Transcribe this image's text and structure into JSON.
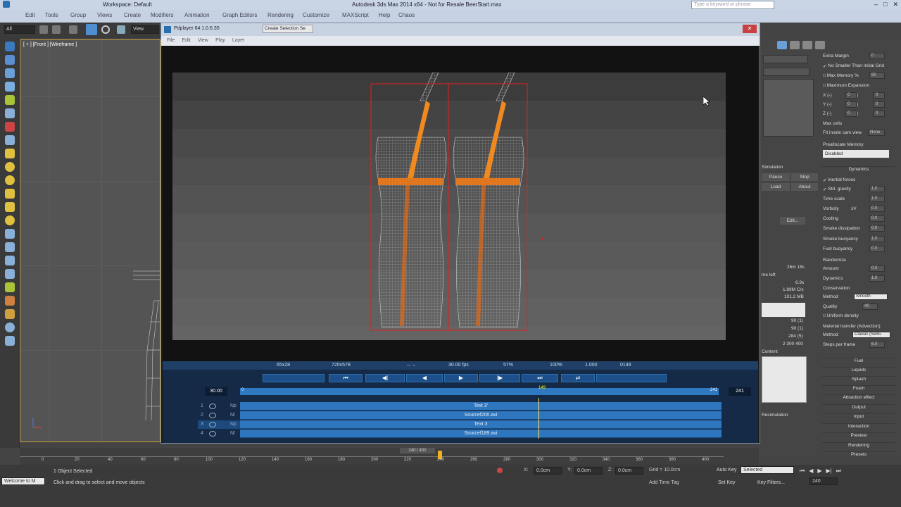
{
  "titlebar": {
    "workspace": "Workspace: Default",
    "title": "Autodesk 3ds Max 2014 x64  -  Not for Resale  BeerStart.max",
    "search_placeholder": "Type a keyword or phrase"
  },
  "menubar": {
    "items": [
      "Edit",
      "Tools",
      "Group",
      "Views",
      "Create",
      "Modifiers",
      "Animation",
      "Graph Editors",
      "Rendering",
      "Customize",
      "MAXScript",
      "Help",
      "Chaos"
    ]
  },
  "toolbar": {
    "filter": "All",
    "view": "View"
  },
  "viewport": {
    "label": "[ + ] [Front ] [Wireframe ]"
  },
  "pdplayer": {
    "title": "Pdplayer 64 1.0.6.35",
    "selection_set": "Create Selection Se",
    "menu": [
      "File",
      "Edit",
      "View",
      "Play",
      "Layer"
    ],
    "numbers": [
      "200",
      "189"
    ],
    "status": {
      "zoom_box": "65x28",
      "resolution": "720x578",
      "arrows": "↔ –",
      "fps": "30.00 fps",
      "opacity": "57%",
      "zoom": "100%",
      "aspect": "1.000",
      "frame": "0149"
    },
    "controls": {
      "fps_field": "30.00",
      "end_field": "241",
      "start_marker": "0",
      "playhead_label": "149",
      "end_marker": "241"
    },
    "layers": [
      {
        "num": "1",
        "tag": "Np",
        "name": "Text 3'"
      },
      {
        "num": "2",
        "tag": "Nl",
        "name": "Sourcef200.avi"
      },
      {
        "num": "3",
        "tag": "Np",
        "name": "Text 3"
      },
      {
        "num": "4",
        "tag": "Nl",
        "name": "Sourcef189.avi"
      }
    ]
  },
  "right_panel": {
    "extra_margin": "Extra Margin",
    "extra_margin_val": "0",
    "no_smaller": "No Smaller Than Initial Grid",
    "max_memory": "Max Memory %",
    "max_memory_val": "90",
    "max_expansion": "Maximum Expansion",
    "x_label": "X (-)",
    "y_label": "Y (-)",
    "z_label": "Z (-)",
    "plus_label": "(+)",
    "xyz_val": "0",
    "max_cells": "Max cells",
    "fit_inside": "Fit inside cam view",
    "fit_val": "None",
    "preallocate": "Preallocate Memory",
    "preallocate_val": "Disabled",
    "dynamics_head": "Dynamics",
    "inertial": "Inertial forces",
    "std_gravity": "Std. gravity",
    "std_gravity_val": "1.0",
    "time_scale": "Time scale",
    "time_scale_val": "1.0",
    "vorticity": "Vorticity",
    "vorticity_xv": "xV",
    "vorticity_val": "0.0",
    "cooling": "Cooling",
    "cooling_val": "0.0",
    "smoke_dissipation": "Smoke dissipation",
    "smoke_dissipation_val": "0.0",
    "smoke_buoyancy": "Smoke buoyancy",
    "smoke_buoyancy_val": "1.0",
    "fuel_buoyancy": "Fuel buoyancy",
    "fuel_buoyancy_val": "0.0",
    "randomize": "Randomize",
    "amount": "Amount",
    "amount_val": "0.0",
    "rand_dynamics": "Dynamics",
    "rand_dynamics_val": "1.0",
    "conservation": "Conservation",
    "method": "Method",
    "method_val": "Smooth",
    "quality": "Quality",
    "quality_val": "40",
    "uniform_density": "Uniform density",
    "material_transfer": "Material transfer (Advection)",
    "method2_val": "Classic (Semi-",
    "steps_per_frame": "Steps per frame",
    "steps_val": "6.0",
    "sections": [
      "Fuel",
      "Liquids",
      "Splash",
      "Foam",
      "Attraction effect",
      "Output",
      "Input",
      "Interaction",
      "Preview",
      "Rendering",
      "Presets"
    ]
  },
  "mid_panel": {
    "simulation": "Simulation",
    "pause": "Pause",
    "stop": "Stop",
    "load": "Load",
    "about": "About",
    "edit": "Edit...",
    "time_val": "26m 18s",
    "time_left": "me left",
    "speed": "6.9s",
    "rate": "1.89M C/s",
    "ram": "101.2 MB",
    "counts": [
      "90 (1)",
      "90 (1)",
      "284 (5)",
      "2 300 400"
    ],
    "content": "Content",
    "resimulation": "Resimulation"
  },
  "timeline": {
    "ticks": [
      "0",
      "20",
      "40",
      "60",
      "80",
      "100",
      "120",
      "140",
      "160",
      "180",
      "200",
      "220",
      "240",
      "260",
      "280",
      "300",
      "320",
      "340",
      "360",
      "380",
      "400"
    ],
    "range": "240 / 400"
  },
  "statusbar": {
    "selected": "1 Object Selected",
    "hint": "Click and drag to select and move objects",
    "welcome": "Welcome to M",
    "x": "0.0cm",
    "y": "0.0cm",
    "z": "0.0cm",
    "grid": "Grid = 10.0cm",
    "add_time_tag": "Add Time Tag",
    "auto_key": "Auto Key",
    "auto_key_val": "Selected",
    "set_key": "Set Key",
    "key_filters": "Key Filters...",
    "frame_val": "240"
  }
}
